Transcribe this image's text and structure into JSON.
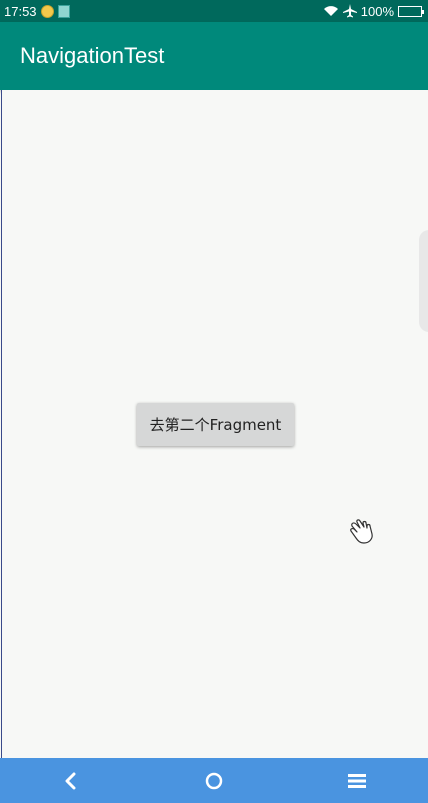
{
  "status_bar": {
    "time": "17:53",
    "battery_text": "100%",
    "icons": [
      "notification-icon",
      "sim-icon",
      "wifi-icon",
      "airplane-icon",
      "battery-icon"
    ]
  },
  "app_bar": {
    "title": "NavigationTest"
  },
  "main": {
    "button_label": "去第二个Fragment"
  },
  "nav_bar": {
    "icons": [
      "back-icon",
      "home-icon",
      "menu-icon"
    ]
  },
  "colors": {
    "status_bar": "#00695c",
    "app_bar": "#00897b",
    "background": "#f7f8f6",
    "nav_bar": "#4a94e0",
    "button": "#d6d7d7"
  }
}
